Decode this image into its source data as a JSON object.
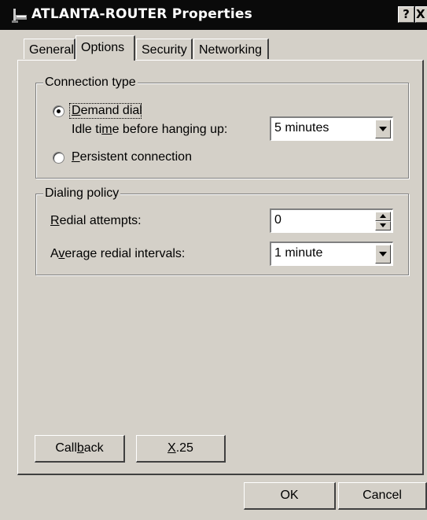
{
  "window": {
    "title": "ATLANTA-ROUTER Properties",
    "help_button": "?",
    "close_button": "X",
    "icon": "router-icon"
  },
  "tabs": [
    {
      "label": "General",
      "active": false
    },
    {
      "label": "Options",
      "active": true
    },
    {
      "label": "Security",
      "active": false
    },
    {
      "label": "Networking",
      "active": false
    }
  ],
  "connection_type": {
    "legend": "Connection type",
    "demand_dial": {
      "prefix": "D",
      "rest": "emand dial",
      "selected": true
    },
    "idle_label": {
      "pre": "Idle ti",
      "u": "m",
      "post": "e before hanging up:"
    },
    "idle_value": "5 minutes",
    "persistent": {
      "prefix": "P",
      "rest": "ersistent connection",
      "selected": false
    }
  },
  "dialing_policy": {
    "legend": "Dialing policy",
    "redial_label": {
      "u": "R",
      "post": "edial attempts:"
    },
    "redial_value": "0",
    "interval_label": {
      "pre": "A",
      "u": "v",
      "post": "erage redial intervals:"
    },
    "interval_value": "1 minute"
  },
  "buttons": {
    "callback": {
      "pre": "Call",
      "u": "b",
      "post": "ack"
    },
    "x25": {
      "u": "X",
      "post": ".25"
    },
    "ok": "OK",
    "cancel": "Cancel"
  }
}
